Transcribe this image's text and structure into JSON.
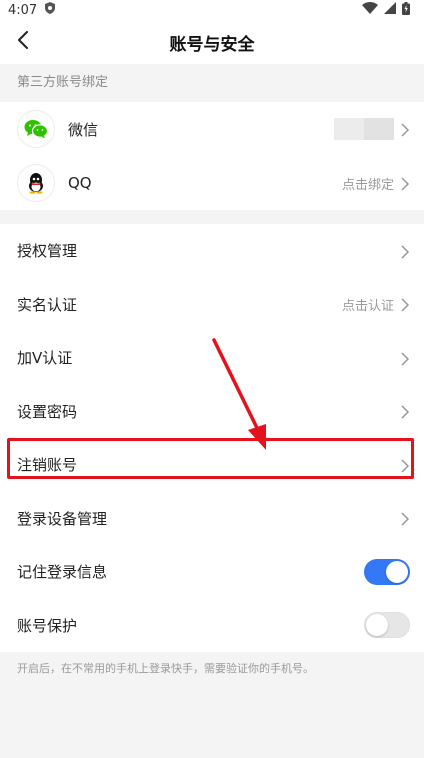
{
  "status": {
    "time": "4:07"
  },
  "nav": {
    "title": "账号与安全"
  },
  "third_party": {
    "header": "第三方账号绑定",
    "accounts": [
      {
        "name": "微信",
        "icon": "wechat-icon",
        "status": ""
      },
      {
        "name": "QQ",
        "icon": "qq-icon",
        "status": "点击绑定"
      }
    ]
  },
  "menu": {
    "items": [
      {
        "label": "授权管理",
        "hint": ""
      },
      {
        "label": "实名认证",
        "hint": "点击认证"
      },
      {
        "label": "加V认证",
        "hint": ""
      },
      {
        "label": "设置密码",
        "hint": ""
      },
      {
        "label": "注销账号",
        "hint": ""
      },
      {
        "label": "登录设备管理",
        "hint": ""
      },
      {
        "label": "记住登录信息",
        "toggle": true
      },
      {
        "label": "账号保护",
        "toggle": false
      }
    ]
  },
  "note": "开启后，在不常用的手机上登录快手，需要验证你的手机号。",
  "colors": {
    "accent": "#3478f6",
    "annotation": "#e3121b"
  }
}
